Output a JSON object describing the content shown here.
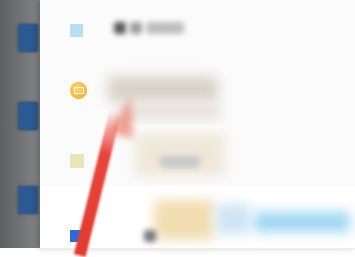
{
  "file_list": {
    "rows": [
      {
        "icon": "file-icon",
        "name": ""
      },
      {
        "icon": "mail-icon",
        "name": ""
      },
      {
        "icon": "document-icon",
        "name": ""
      },
      {
        "icon": "file-icon-blue",
        "name": ""
      }
    ]
  },
  "colors": {
    "backdrop": "#6f7174",
    "folder": "#2a5a8f",
    "accent_red": "#e23b30",
    "accent_blue": "#2a6bd6"
  }
}
